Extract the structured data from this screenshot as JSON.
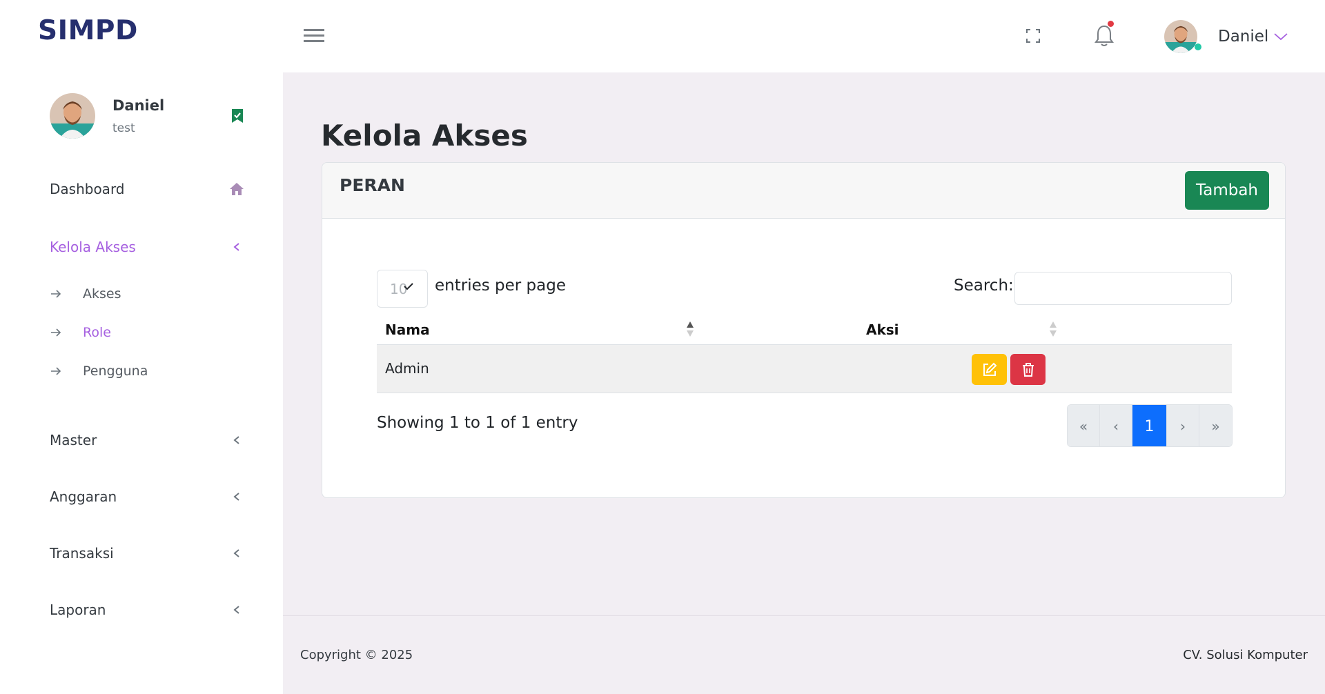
{
  "app": {
    "brand": "SIMPD"
  },
  "user": {
    "name": "Daniel",
    "role": "test"
  },
  "sidebar": {
    "items": [
      {
        "label": "Dashboard",
        "icon": "home-icon"
      },
      {
        "label": "Kelola Akses",
        "icon": "chevron-left-icon",
        "active": true,
        "children": [
          {
            "label": "Akses"
          },
          {
            "label": "Role",
            "active": true
          },
          {
            "label": "Pengguna"
          }
        ]
      },
      {
        "label": "Master",
        "icon": "chevron-left-icon"
      },
      {
        "label": "Anggaran",
        "icon": "chevron-left-icon"
      },
      {
        "label": "Transaksi",
        "icon": "chevron-left-icon"
      },
      {
        "label": "Laporan",
        "icon": "chevron-left-icon"
      }
    ]
  },
  "topbar": {
    "user_name": "Daniel"
  },
  "page": {
    "title": "Kelola Akses"
  },
  "card": {
    "title": "PERAN",
    "add_label": "Tambah",
    "length_value": "10",
    "length_label": "entries per page",
    "search_label": "Search:",
    "search_value": "",
    "columns": [
      "Nama",
      "Aksi"
    ],
    "rows": [
      {
        "nama": "Admin"
      }
    ],
    "info": "Showing 1 to 1 of 1 entry",
    "pagination": [
      "«",
      "‹",
      "1",
      "›",
      "»"
    ],
    "current_page": "1"
  },
  "footer": {
    "copyright": "Copyright © 2025",
    "company": "CV. Solusi Komputer"
  },
  "colors": {
    "accent": "#a660e0",
    "primary": "#0d6efd",
    "success": "#198754",
    "warning": "#ffc107",
    "danger": "#dc3545",
    "brand": "#262f6e"
  }
}
